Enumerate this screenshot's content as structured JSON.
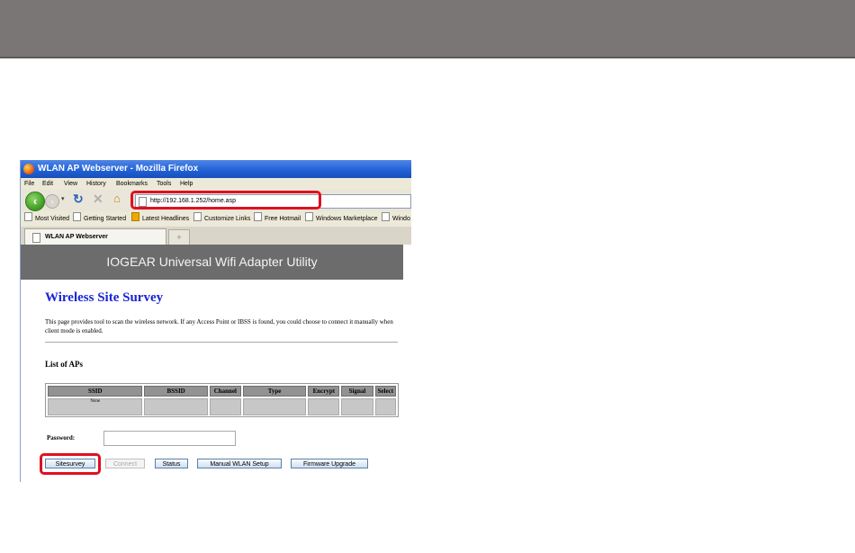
{
  "window": {
    "title": "WLAN AP Webserver - Mozilla Firefox"
  },
  "menubar": {
    "items": [
      "File",
      "Edit",
      "View",
      "History",
      "Bookmarks",
      "Tools",
      "Help"
    ]
  },
  "navbar": {
    "url": "http://192.168.1.252/home.asp"
  },
  "bookmarks": {
    "items": [
      "Most Visited",
      "Getting Started",
      "Latest Headlines",
      "Customize Links",
      "Free Hotmail",
      "Windows Marketplace",
      "Windo"
    ]
  },
  "tabs": {
    "active_label": "WLAN AP Webserver",
    "new_tab_label": "+"
  },
  "page": {
    "banner": "IOGEAR Universal Wifi Adapter Utility",
    "heading": "Wireless Site Survey",
    "description": "This page provides tool to scan the wireless network. If any Access Point or IBSS is found, you could choose to connect it manually when client mode is enabled.",
    "list_heading": "List of APs",
    "table": {
      "columns": [
        "SSID",
        "BSSID",
        "Channel",
        "Type",
        "Encrypt",
        "Signal",
        "Select"
      ],
      "rows": [
        [
          "None",
          "",
          "",
          "",
          "",
          "",
          ""
        ]
      ]
    },
    "password_label": "Password:",
    "password_value": "",
    "buttons": {
      "sitesurvey": "Sitesurvey",
      "connect": "Connect",
      "status": "Status",
      "manual": "Manual WLAN Setup",
      "firmware": "Firmware Upgrade"
    }
  },
  "colors": {
    "highlight": "#e01020",
    "banner": "#6c6c6c",
    "heading": "#1a25d6",
    "header_bar": "#7a7676"
  }
}
